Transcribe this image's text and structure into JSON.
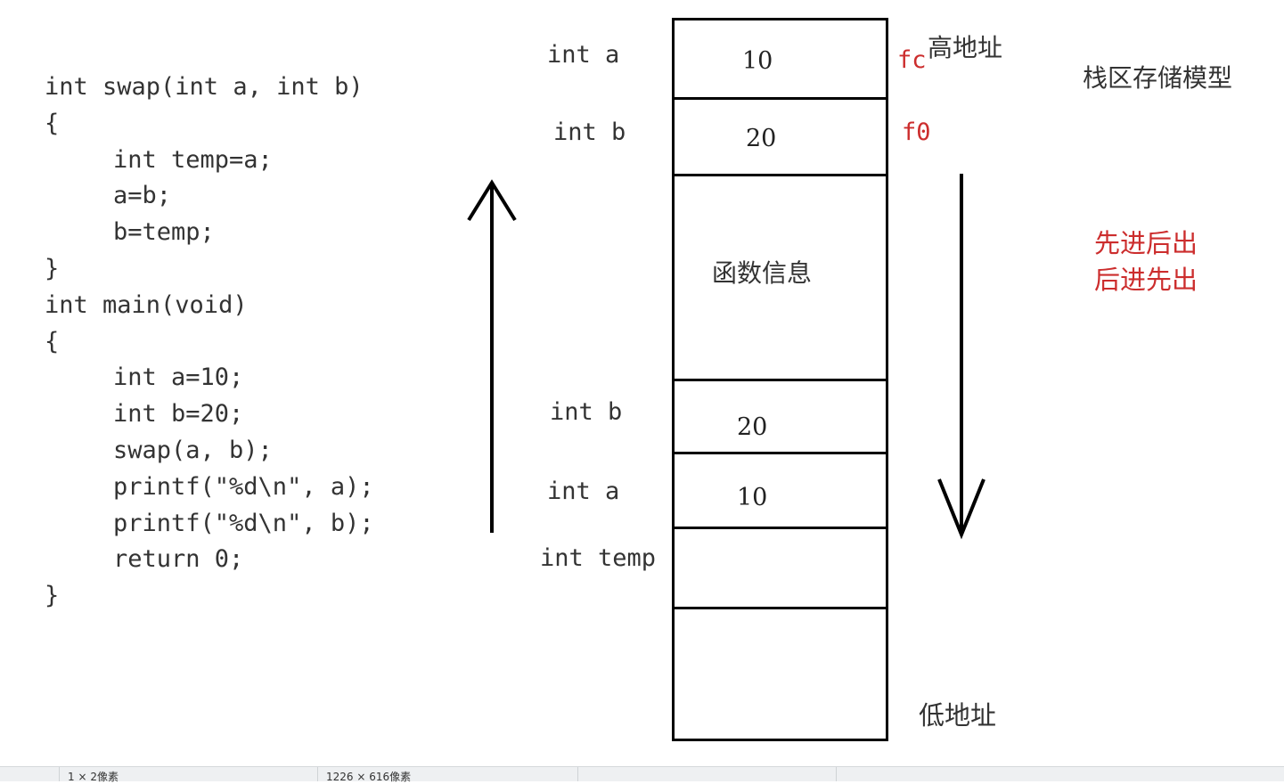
{
  "code": {
    "lines": [
      {
        "text": "int swap(int a, int b)",
        "indent": false
      },
      {
        "text": "{",
        "indent": false
      },
      {
        "text": "int temp=a;",
        "indent": true
      },
      {
        "text": "a=b;",
        "indent": true
      },
      {
        "text": "b=temp;",
        "indent": true
      },
      {
        "text": "}",
        "indent": false
      },
      {
        "text": "int main(void)",
        "indent": false
      },
      {
        "text": "{",
        "indent": false
      },
      {
        "text": "int a=10;",
        "indent": true
      },
      {
        "text": "int b=20;",
        "indent": true
      },
      {
        "text": "swap(a, b);",
        "indent": true
      },
      {
        "text": "printf(\"%d\\n\", a);",
        "indent": true
      },
      {
        "text": "printf(\"%d\\n\", b);",
        "indent": true
      },
      {
        "text": "return 0;",
        "indent": true
      },
      {
        "text": "}",
        "indent": false
      }
    ]
  },
  "stack": {
    "labels": {
      "top_a": "int a",
      "top_b": "int b",
      "mid_b": "int b",
      "mid_a": "int a",
      "temp": "int temp"
    },
    "values": {
      "top_a": "10",
      "top_b": "20",
      "func_info": "函数信息",
      "mid_b": "20",
      "mid_a": "10"
    }
  },
  "annotations": {
    "addr_fc": "fc",
    "addr_f0": "f0",
    "high_address": "高地址",
    "low_address": "低地址",
    "title": "栈区存储模型",
    "rule_line1": "先进后出",
    "rule_line2": "后进先出"
  },
  "statusbar": {
    "left": "1 × 2像素",
    "right": "1226 × 616像素"
  },
  "colors": {
    "accent_red": "#cc2d2d",
    "stroke": "#000000"
  }
}
